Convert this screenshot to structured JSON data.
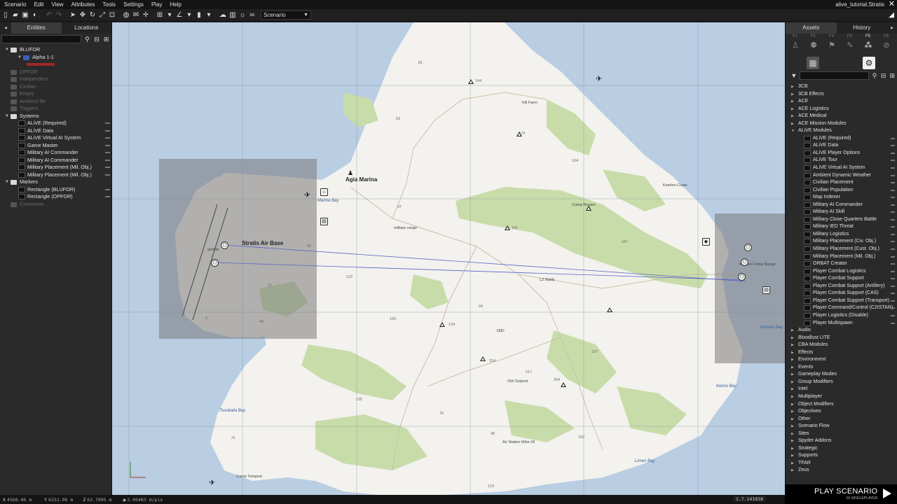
{
  "menu": [
    "Scenario",
    "Edit",
    "View",
    "Attributes",
    "Tools",
    "Settings",
    "Play",
    "Help"
  ],
  "window_title": "alive_tutorial.Stratis",
  "toolbar": {
    "scenario_select": "Scenario"
  },
  "left_panel": {
    "tabs": [
      "Entities",
      "Locations"
    ],
    "tree": [
      {
        "label": "BLUFOR",
        "level": 0,
        "type": "folder",
        "expanded": true
      },
      {
        "label": "Alpha 1-1",
        "level": 1,
        "type": "group",
        "expanded": true
      },
      {
        "label": "OPFOR",
        "level": 0,
        "type": "folder",
        "dim": true
      },
      {
        "label": "Independent",
        "level": 0,
        "type": "folder",
        "dim": true
      },
      {
        "label": "Civilian",
        "level": 0,
        "type": "folder",
        "dim": true
      },
      {
        "label": "Empty",
        "level": 0,
        "type": "folder",
        "dim": true
      },
      {
        "label": "Ambient life",
        "level": 0,
        "type": "folder",
        "dim": true
      },
      {
        "label": "Triggers",
        "level": 0,
        "type": "folder",
        "dim": true
      },
      {
        "label": "Systems",
        "level": 0,
        "type": "folder",
        "expanded": true
      },
      {
        "label": "ALiVE (Required)",
        "level": 1,
        "type": "module"
      },
      {
        "label": "ALiVE Data",
        "level": 1,
        "type": "module"
      },
      {
        "label": "ALiVE Virtual AI System",
        "level": 1,
        "type": "module"
      },
      {
        "label": "Game Master",
        "level": 1,
        "type": "module"
      },
      {
        "label": "Military AI Commander",
        "level": 1,
        "type": "module"
      },
      {
        "label": "Military AI Commander",
        "level": 1,
        "type": "module"
      },
      {
        "label": "Military Placement (Mil. Obj.)",
        "level": 1,
        "type": "module"
      },
      {
        "label": "Military Placement (Mil. Obj.)",
        "level": 1,
        "type": "module"
      },
      {
        "label": "Markers",
        "level": 0,
        "type": "folder",
        "expanded": true
      },
      {
        "label": "Rectangle (BLUFOR)",
        "level": 1,
        "type": "module"
      },
      {
        "label": "Rectangle (OPFOR)",
        "level": 1,
        "type": "module"
      },
      {
        "label": "Comments",
        "level": 0,
        "type": "folder",
        "dim": true
      }
    ]
  },
  "right_panel": {
    "tabs": [
      "Assets",
      "History"
    ],
    "fkeys": [
      "F1",
      "F2",
      "F3",
      "F4",
      "F5",
      "F6"
    ],
    "categories": [
      {
        "label": "3CB"
      },
      {
        "label": "3CB Effects"
      },
      {
        "label": "ACE"
      },
      {
        "label": "ACE Logistics"
      },
      {
        "label": "ACE Medical"
      },
      {
        "label": "ACE Mission Modules"
      },
      {
        "label": "ALiVE Modules",
        "expanded": true,
        "children": [
          "ALiVE (Required)",
          "ALiVE Data",
          "ALiVE Player Options",
          "ALiVE Tour",
          "ALiVE Virtual AI System",
          "Ambient Dynamic Weather",
          "Civilian Placement",
          "Civilian Population",
          "Map Indexer",
          "Military AI Commander",
          "Military AI Skill",
          "Military Close Quarters Battle",
          "Military IED Threat",
          "Military Logistics",
          "Military Placement (Civ. Obj.)",
          "Military Placement (Cust. Obj.)",
          "Military Placement (Mil. Obj.)",
          "ORBAT Creator",
          "Player Combat Logistics",
          "Player Combat Support",
          "Player Combat Support (Artillery)",
          "Player Combat Support (CAS)",
          "Player Combat Support (Transport)",
          "Player Command/Control (C2ISTAR)",
          "Player Logistics (Disable)",
          "Player Multispawn"
        ]
      },
      {
        "label": "Audio"
      },
      {
        "label": "Bloodlust LITE"
      },
      {
        "label": "CBA Modules"
      },
      {
        "label": "Effects"
      },
      {
        "label": "Environment"
      },
      {
        "label": "Events"
      },
      {
        "label": "Gameplay Modes"
      },
      {
        "label": "Group Modifiers"
      },
      {
        "label": "Intel"
      },
      {
        "label": "Multiplayer"
      },
      {
        "label": "Object Modifiers"
      },
      {
        "label": "Objectives"
      },
      {
        "label": "Other"
      },
      {
        "label": "Scenario Flow"
      },
      {
        "label": "Sites"
      },
      {
        "label": "Spyder Addons"
      },
      {
        "label": "Strategic"
      },
      {
        "label": "Supports"
      },
      {
        "label": "TFAR"
      },
      {
        "label": "Zeus"
      }
    ]
  },
  "play": {
    "title": "PLAY SCENARIO",
    "subtitle": "IN SINGLEPLAYER"
  },
  "status": {
    "x": "4568.46 m",
    "y": "6152.96 m",
    "z": "63.7095 m",
    "speed": "2.05463 m/pix",
    "version": "1.7.141838"
  },
  "map": {
    "colors": {
      "water": "#b9cde3",
      "land": "#f3f2ee",
      "forest": "#c8dcaa",
      "zone": "#8a8a8a"
    },
    "labels": [
      {
        "text": "Agia Marina",
        "kind": "big"
      },
      {
        "text": "Stratis Air Base",
        "kind": "big"
      },
      {
        "text": "Marina Bay",
        "kind": "water"
      },
      {
        "text": "Kill Farm",
        "kind": "cap"
      },
      {
        "text": "Camp Rogain",
        "kind": "cap"
      },
      {
        "text": "Kamino Coast",
        "kind": "cap"
      },
      {
        "text": "Kamino Firing Range",
        "kind": "cap"
      },
      {
        "text": "Kamino Bay",
        "kind": "water"
      },
      {
        "text": "Keiros Bay",
        "kind": "water"
      },
      {
        "text": "LZ Baldy",
        "kind": "cap"
      },
      {
        "text": "Old Outpost",
        "kind": "cap"
      },
      {
        "text": "Air Station Mike-26",
        "kind": "cap"
      },
      {
        "text": "Camp Tempest",
        "kind": "cap"
      },
      {
        "text": "Limeri Bay",
        "kind": "water"
      },
      {
        "text": "Tsoukalia Bay",
        "kind": "water"
      },
      {
        "text": "military range",
        "kind": "cap"
      },
      {
        "text": "airfield",
        "kind": "cap"
      },
      {
        "text": "81",
        "kind": "num"
      },
      {
        "text": "144",
        "kind": "num"
      },
      {
        "text": "53",
        "kind": "num"
      },
      {
        "text": "174",
        "kind": "num"
      },
      {
        "text": "37",
        "kind": "num"
      },
      {
        "text": "164",
        "kind": "num"
      },
      {
        "text": "141",
        "kind": "num"
      },
      {
        "text": "187",
        "kind": "num"
      },
      {
        "text": "110",
        "kind": "num"
      },
      {
        "text": "94",
        "kind": "num"
      },
      {
        "text": "116",
        "kind": "num"
      },
      {
        "text": "160",
        "kind": "num"
      },
      {
        "text": "134",
        "kind": "num"
      },
      {
        "text": "161",
        "kind": "num"
      },
      {
        "text": "154",
        "kind": "num"
      },
      {
        "text": "217",
        "kind": "num"
      },
      {
        "text": "264",
        "kind": "num"
      },
      {
        "text": "197",
        "kind": "num"
      },
      {
        "text": "135",
        "kind": "num"
      },
      {
        "text": "76",
        "kind": "num"
      },
      {
        "text": "21",
        "kind": "num"
      },
      {
        "text": "152",
        "kind": "num"
      },
      {
        "text": "40",
        "kind": "num"
      },
      {
        "text": "6",
        "kind": "num"
      },
      {
        "text": "66",
        "kind": "num"
      },
      {
        "text": "57",
        "kind": "num"
      },
      {
        "text": "123",
        "kind": "num"
      },
      {
        "text": "49",
        "kind": "num"
      }
    ]
  }
}
